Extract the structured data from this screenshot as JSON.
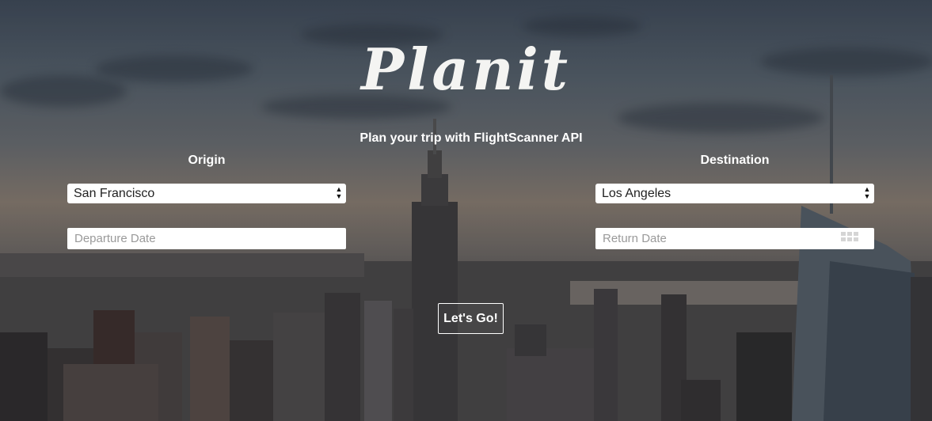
{
  "app": {
    "logo": "Planit",
    "subtitle": "Plan your trip with FlightScanner API"
  },
  "origin": {
    "label": "Origin",
    "selected": "San Francisco",
    "date_placeholder": "Departure Date"
  },
  "destination": {
    "label": "Destination",
    "selected": "Los Angeles",
    "date_placeholder": "Return Date"
  },
  "actions": {
    "submit_label": "Let's Go!"
  },
  "icons": {
    "select_arrows": "updown-arrows-icon",
    "calendar": "calendar-icon"
  },
  "colors": {
    "text": "#ffffff",
    "field_bg": "#ffffff",
    "placeholder": "#9a9a9a"
  }
}
